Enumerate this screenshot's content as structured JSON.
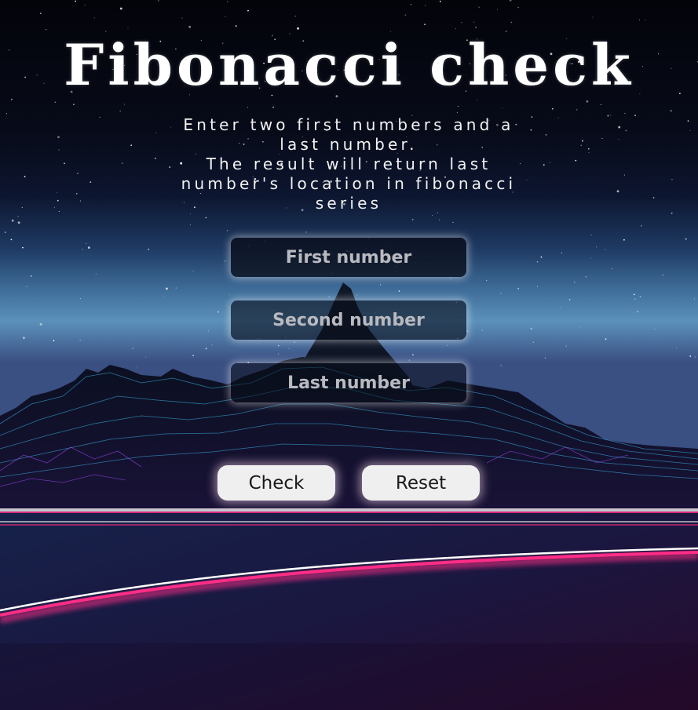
{
  "title": "Fibonacci check",
  "description": {
    "line1": "Enter two first numbers and a",
    "line2": "last number.",
    "line3": "The result will return last",
    "line4": "number's location in fibonacci",
    "line5": "series"
  },
  "form": {
    "first_placeholder": "First number",
    "second_placeholder": "Second number",
    "last_placeholder": "Last number",
    "first_value": "",
    "second_value": "",
    "last_value": ""
  },
  "buttons": {
    "check_label": "Check",
    "reset_label": "Reset"
  },
  "colors": {
    "sky_top": "#05060c",
    "sky_horizon": "#5b91bb",
    "neon_pink": "#ff2d86",
    "neon_cyan": "#3fe6ff",
    "button_bg": "#efefef"
  }
}
